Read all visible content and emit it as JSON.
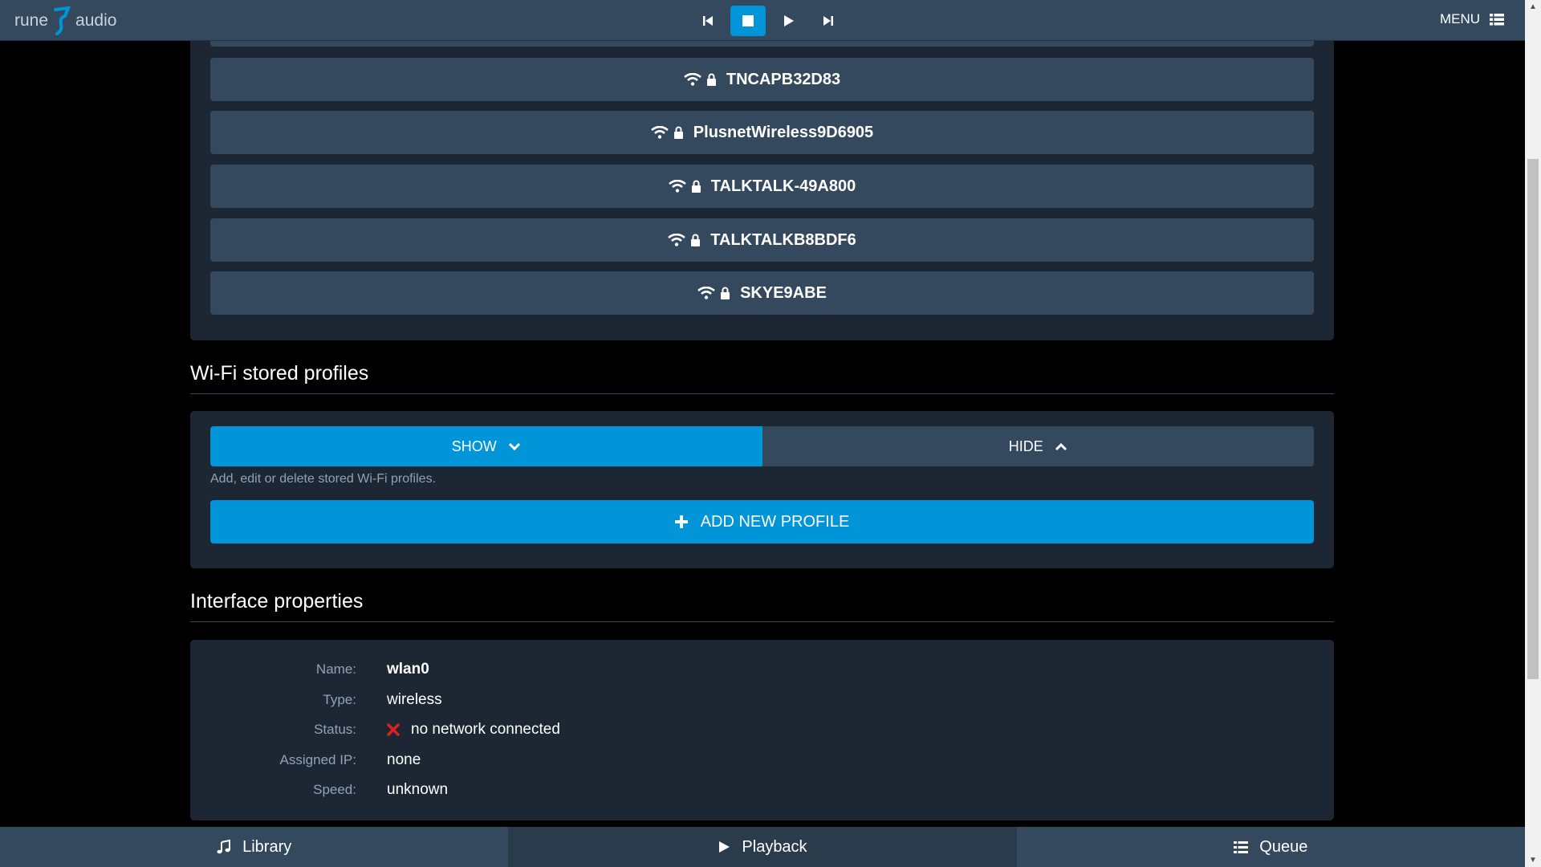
{
  "app": {
    "logo_left": "rune",
    "logo_right": "audio",
    "menu_label": "MENU"
  },
  "transport": {
    "icons": [
      "previous-icon",
      "stop-icon",
      "play-icon",
      "next-icon"
    ],
    "active": "stop"
  },
  "networks": [
    {
      "ssid": "TNCAPB32D83",
      "secured": true
    },
    {
      "ssid": "PlusnetWireless9D6905",
      "secured": true
    },
    {
      "ssid": "TALKTALK-49A800",
      "secured": true
    },
    {
      "ssid": "TALKTALKB8BDF6",
      "secured": true
    },
    {
      "ssid": "SKYE9ABE",
      "secured": true
    }
  ],
  "stored_profiles": {
    "title": "Wi-Fi stored profiles",
    "show_label": "SHOW",
    "hide_label": "HIDE",
    "help_text": "Add, edit or delete stored Wi-Fi profiles.",
    "add_label": "ADD NEW PROFILE"
  },
  "interface": {
    "title": "Interface properties",
    "rows": [
      {
        "label": "Name:",
        "value": "wlan0"
      },
      {
        "label": "Type:",
        "value": "wireless"
      },
      {
        "label": "Status:",
        "value": "no network connected"
      },
      {
        "label": "Assigned IP:",
        "value": "none"
      },
      {
        "label": "Speed:",
        "value": "unknown"
      }
    ]
  },
  "bottom_tabs": [
    {
      "label": "Library",
      "icon": "music-note-icon"
    },
    {
      "label": "Playback",
      "icon": "play-icon"
    },
    {
      "label": "Queue",
      "icon": "list-icon"
    }
  ],
  "colors": {
    "accent": "#0095d8",
    "bar": "#34495e",
    "panel": "#1c2733",
    "error": "#e02020"
  }
}
